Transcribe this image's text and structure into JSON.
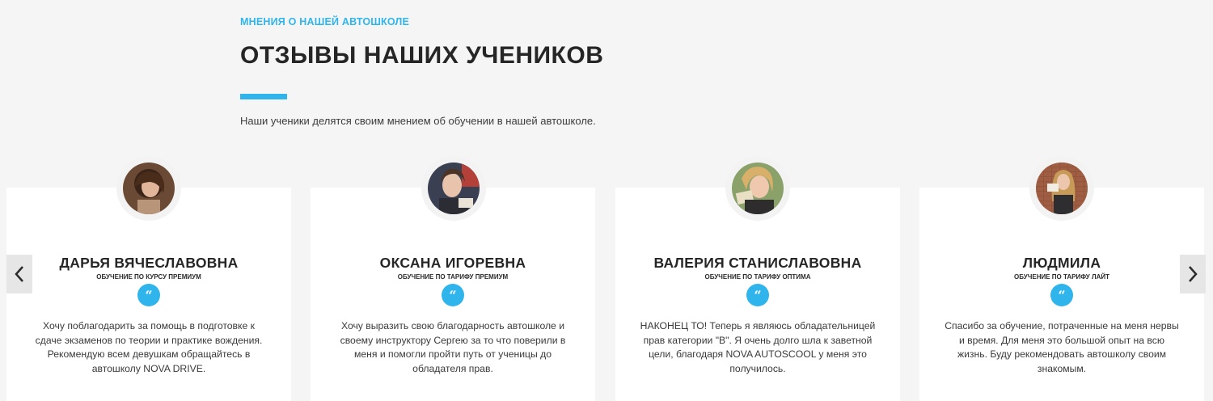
{
  "section": {
    "eyebrow": "МНЕНИЯ О НАШЕЙ АВТОШКОЛЕ",
    "title": "ОТЗЫВЫ НАШИХ УЧЕНИКОВ",
    "subtitle": "Наши ученики делятся своим мнением об обучении в нашей автошколе."
  },
  "reviews": [
    {
      "name": "ДАРЬЯ ВЯЧЕСЛАВОВНА",
      "plan": "ОБУЧЕНИЕ ПО КУРСУ ПРЕМИУМ",
      "text": "Хочу поблагодарить за помощь в подготовке к сдаче экзаменов по теории и практике вождения. Рекомендую всем девушкам обращайтесь в автошколу NOVA DRIVE."
    },
    {
      "name": "ОКСАНА ИГОРЕВНА",
      "plan": "ОБУЧЕНИЕ ПО ТАРИФУ ПРЕМИУМ",
      "text": "Хочу выразить свою благодарность автошколе и своему инструктору Сергею за то что поверили в меня и помогли пройти путь от ученицы до обладателя прав."
    },
    {
      "name": "ВАЛЕРИЯ СТАНИСЛАВОВНА",
      "plan": "ОБУЧЕНИЕ ПО ТАРИФУ ОПТИМА",
      "text": "НАКОНЕЦ ТО! Теперь я являюсь обладательницей прав категории \"В\". Я очень долго шла к заветной цели, благодаря NOVA AUTOSCOOL у меня это получилось."
    },
    {
      "name": "ЛЮДМИЛА",
      "plan": "ОБУЧЕНИЕ ПО ТАРИФУ ЛАЙТ",
      "text": "Спасибо за обучение, потраченные на меня нервы и время. Для меня это большой опыт на всю жизнь. Буду рекомендовать автошколу своим знакомым."
    }
  ],
  "quote_glyph": "“",
  "colors": {
    "accent": "#2fb5ec",
    "background": "#f5f5f5",
    "card": "#ffffff"
  },
  "icons": {
    "prev": "chevron-left-icon",
    "next": "chevron-right-icon",
    "quote": "quote-icon"
  }
}
